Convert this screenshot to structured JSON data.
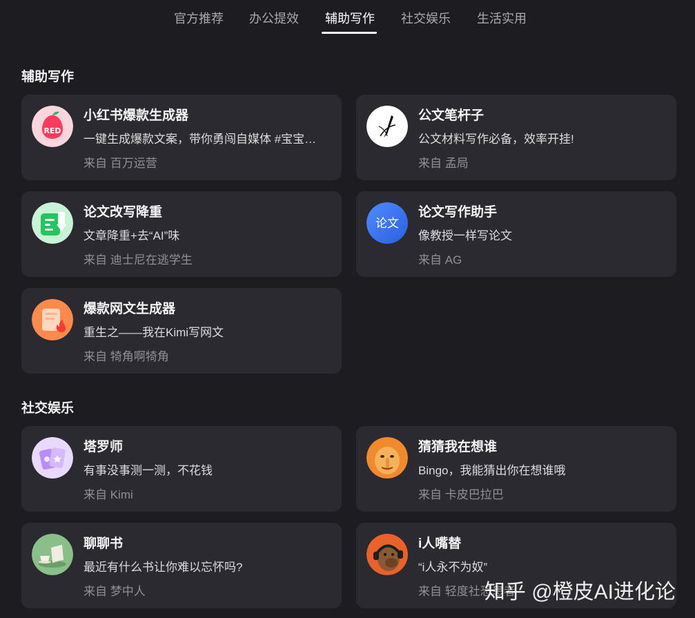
{
  "tabs": [
    {
      "label": "官方推荐"
    },
    {
      "label": "办公提效"
    },
    {
      "label": "辅助写作",
      "active": true
    },
    {
      "label": "社交娱乐"
    },
    {
      "label": "生活实用"
    }
  ],
  "sections": [
    {
      "title": "辅助写作",
      "cards": [
        {
          "name": "小红书爆款生成器",
          "desc": "一键生成爆款文案，带你勇闯自媒体 #宝宝…",
          "source": "来自 百万运营",
          "icon": "red-pear-icon"
        },
        {
          "name": "公文笔杆子",
          "desc": "公文材料写作必备，效率开挂!",
          "source": "来自 孟局",
          "icon": "pen-nib-icon"
        },
        {
          "name": "论文改写降重",
          "desc": "文章降重+去“AI”味",
          "source": "来自 迪士尼在逃学生",
          "icon": "document-download-icon"
        },
        {
          "name": "论文写作助手",
          "desc": "像教授一样写论文",
          "source": "来自 AG",
          "icon": "lunwen-badge-icon",
          "icon_text": "论文"
        },
        {
          "name": "爆款网文生成器",
          "desc": "重生之——我在Kimi写网文",
          "source": "来自 犄角啊犄角",
          "icon": "book-fire-icon"
        }
      ]
    },
    {
      "title": "社交娱乐",
      "cards": [
        {
          "name": "塔罗师",
          "desc": "有事没事测一测，不花钱",
          "source": "来自 Kimi",
          "icon": "tarot-cards-icon"
        },
        {
          "name": "猜猜我在想谁",
          "desc": "Bingo，我能猜出你在想谁哦",
          "source": "来自 卡皮巴拉巴",
          "icon": "shush-face-icon"
        },
        {
          "name": "聊聊书",
          "desc": "最近有什么书让你难以忘怀吗?",
          "source": "来自 梦中人",
          "icon": "book-teacup-icon"
        },
        {
          "name": "i人嘴替",
          "desc": "“i人永不为奴”",
          "source": "来自 轻度社恐患者",
          "icon": "headphone-capybara-icon"
        }
      ]
    }
  ],
  "watermark": "知乎 @橙皮AI进化论",
  "colors": {
    "background": "#1d1d21",
    "card": "#2a2a30",
    "active_tab": "#ffffff",
    "inactive_tab": "#a9a9ae"
  }
}
